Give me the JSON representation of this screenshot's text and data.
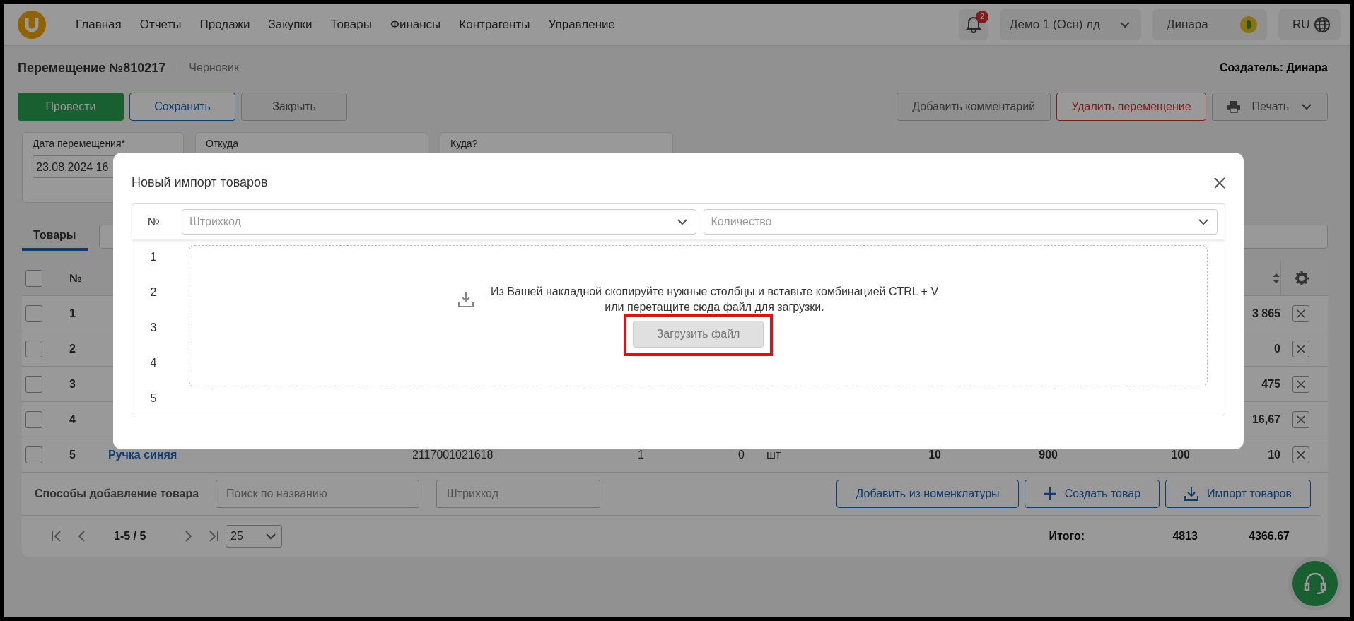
{
  "nav": {
    "items": [
      "Главная",
      "Отчеты",
      "Продажи",
      "Закупки",
      "Товары",
      "Финансы",
      "Контрагенты",
      "Управление"
    ],
    "notifications": "2",
    "company": "Демо 1 (Осн) лд",
    "user": "Динара",
    "language": "RU"
  },
  "document": {
    "title": "Перемещение №810217",
    "status": "Черновик",
    "creator": "Создатель: Динара"
  },
  "actions_left": [
    {
      "label": "Провести",
      "kind": "success"
    },
    {
      "label": "Сохранить",
      "kind": "outline"
    },
    {
      "label": "Закрыть",
      "kind": "plain"
    }
  ],
  "actions_right": [
    {
      "label": "Добавить комментарий",
      "kind": "plain"
    },
    {
      "label": "Удалить перемещение",
      "kind": "danger"
    },
    {
      "label": "Печать",
      "kind": "print"
    }
  ],
  "fields": [
    {
      "label": "Дата перемещения*",
      "value": "23.08.2024 16"
    },
    {
      "label": "Откуда"
    },
    {
      "label": "Куда?"
    }
  ],
  "tabs": [
    {
      "label": "Товары",
      "selected": true
    }
  ],
  "table": {
    "header": {
      "number": "№",
      "checked": false
    },
    "rows": [
      {
        "checked": false,
        "number": "1",
        "column_11": "3 865"
      },
      {
        "checked": false,
        "number": "2",
        "column_11": "0"
      },
      {
        "checked": false,
        "number": "3",
        "column_11": "475"
      },
      {
        "checked": false,
        "number": "4",
        "column_11": "16,67"
      },
      {
        "checked": false,
        "number": "5",
        "name": "Ручка синяя",
        "barcode": "2117001021618",
        "column_5": "1",
        "column_6": "0",
        "unit": "шт",
        "column_8": "10",
        "column_9": "900",
        "column_10": "100",
        "column_11": "10"
      }
    ]
  },
  "add_bar": {
    "label": "Способы добавление товара",
    "search_placeholder": "Поиск по названию",
    "barcode_placeholder": "Штрихкод",
    "buttons": [
      {
        "label": "Добавить из номенклатуры",
        "kind": "plain"
      },
      {
        "label": "Создать товар",
        "kind": "plus"
      },
      {
        "label": "Импорт товаров",
        "kind": "import"
      }
    ]
  },
  "pagination": {
    "range": "1-5 / 5",
    "page_size": "25"
  },
  "totals": {
    "label": "Итого:",
    "values": [
      "4813",
      "4366.67"
    ]
  },
  "modal": {
    "title": "Новый импорт товаров",
    "number_header": "№",
    "column_selects": [
      {
        "placeholder": "Штрихкод"
      },
      {
        "placeholder": "Количество"
      }
    ],
    "row_numbers": [
      "1",
      "2",
      "3",
      "4",
      "5"
    ],
    "hint": "Из Вашей накладной скопируйте нужные столбцы и вставьте комбинацией CTRL + V\nили перетащите сюда файл для загрузки.",
    "upload_button": "Загрузить файл",
    "highlighted": true
  }
}
